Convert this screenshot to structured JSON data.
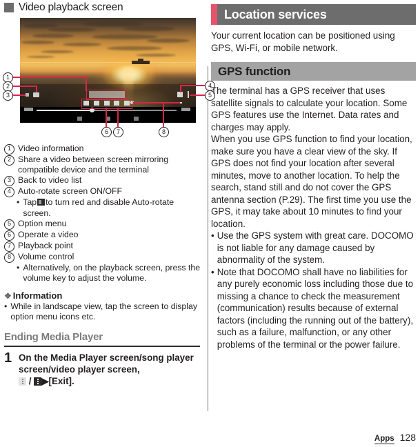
{
  "left": {
    "heading": "Video playback screen",
    "figure": {
      "callouts": [
        "1",
        "2",
        "3",
        "4",
        "5",
        "6",
        "7",
        "8"
      ],
      "screen_alt": "Video player screen showing a sunset over the ocean with playback controls"
    },
    "legend": [
      {
        "num": "1",
        "text": "Video information"
      },
      {
        "num": "2",
        "text": "Share a video between screen mirroring compatible device and the terminal"
      },
      {
        "num": "3",
        "text": "Back to video list"
      },
      {
        "num": "4",
        "text": "Auto-rotate screen ON/OFF",
        "sub": [
          {
            "before": "Tap",
            "icon": "auto-rotate-icon",
            "after": "to turn red and disable Auto-rotate screen."
          }
        ]
      },
      {
        "num": "5",
        "text": "Option menu"
      },
      {
        "num": "6",
        "text": "Operate a video"
      },
      {
        "num": "7",
        "text": "Playback point"
      },
      {
        "num": "8",
        "text": "Volume control",
        "sub": [
          {
            "before": "Alternatively, on the playback screen, press the volume key to adjust the volume.",
            "icon": "",
            "after": ""
          }
        ]
      }
    ],
    "information": {
      "label": "Information",
      "marker": "❖",
      "bullets": [
        "While in landscape view, tap the screen to display option menu icons etc."
      ]
    },
    "section": {
      "title": "Ending Media Player",
      "step_number": "1",
      "step_text_1": "On the Media Player screen/song player screen/video player screen,",
      "step_sep": "/",
      "step_arrow": "▶",
      "step_text_2": "[Exit]."
    }
  },
  "right": {
    "main_bar": "Location services",
    "intro": "Your current location can be positioned using GPS, Wi-Fi, or mobile network.",
    "sub_bar": "GPS function",
    "body": "The terminal has a GPS receiver that uses satellite signals to calculate your location. Some GPS features use the Internet. Data rates and charges may apply.\nWhen you use GPS function to find your location, make sure you have a clear view of the sky. If GPS does not find your location after several minutes, move to another location. To help the search, stand still and do not cover the GPS antenna section (P.29). The first time you use the GPS, it may take about 10 minutes to find your location.",
    "bullets": [
      "Use the GPS system with great care. DOCOMO is not liable for any damage caused by abnormality of the system.",
      "Note that DOCOMO shall have no liabilities for any purely economic loss including those due to missing a chance to check the measurement (communication) results because of external factors (including the running out of the battery), such as a failure, malfunction, or any other problems of the terminal or the power failure."
    ]
  },
  "footer": {
    "section_label": "Apps",
    "page_number": "128"
  },
  "colors": {
    "accent": "#e4546b",
    "bar_dark": "#6d6d6d",
    "bar_light": "#a3a3a3",
    "callout_red": "#d8254b",
    "text": "#231f20"
  }
}
